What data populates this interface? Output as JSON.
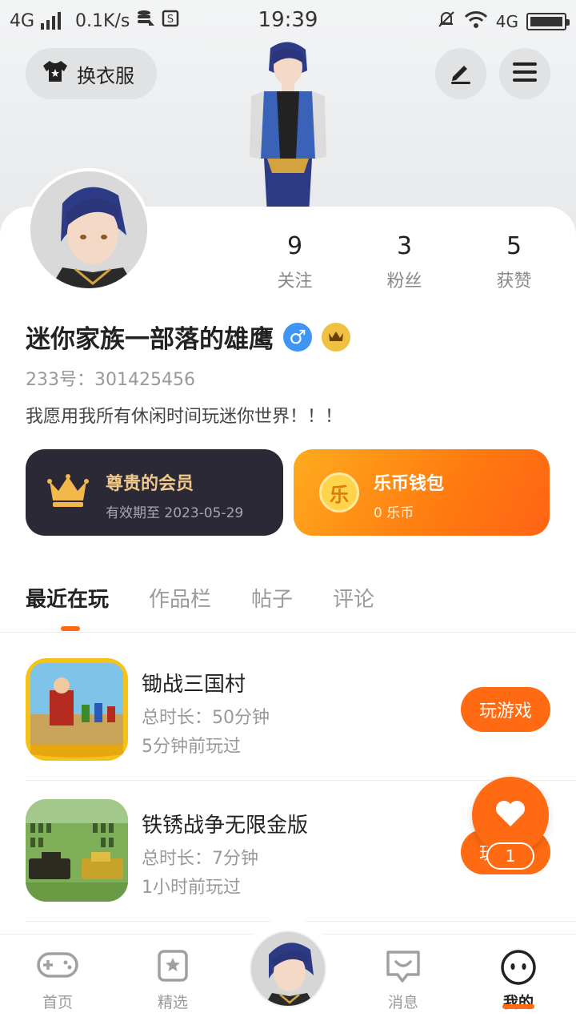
{
  "status_bar": {
    "network": "4G",
    "speed": "0.1K/s",
    "time": "19:39",
    "right_network": "4G"
  },
  "header": {
    "outfit_button_label": "换衣服",
    "edit_icon": "pencil-icon",
    "menu_icon": "menu-icon"
  },
  "profile": {
    "stats": [
      {
        "value": "9",
        "label": "关注"
      },
      {
        "value": "3",
        "label": "粉丝"
      },
      {
        "value": "5",
        "label": "获赞"
      }
    ],
    "nickname": "迷你家族一部落的雄鹰",
    "gender_symbol": "♂",
    "uid_text": "233号：301425456",
    "bio": "我愿用我所有休闲时间玩迷你世界！！！"
  },
  "member_card": {
    "title": "尊贵的会员",
    "subtitle": "有效期至 2023-05-29"
  },
  "wallet_card": {
    "coin_glyph": "乐",
    "title": "乐币钱包",
    "subtitle": "0 乐币"
  },
  "tabs": [
    {
      "label": "最近在玩",
      "active": true
    },
    {
      "label": "作品栏",
      "active": false
    },
    {
      "label": "帖子",
      "active": false
    },
    {
      "label": "评论",
      "active": false
    }
  ],
  "games": [
    {
      "name": "锄战三国村",
      "duration": "总时长：50分钟",
      "last_played": "5分钟前玩过",
      "button": "玩游戏"
    },
    {
      "name": "铁锈战争无限金版",
      "duration": "总时长：7分钟",
      "last_played": "1小时前玩过",
      "button": "玩游戏"
    }
  ],
  "like_fab": {
    "count": "1"
  },
  "bottom_nav": [
    {
      "label": "首页",
      "icon": "gamepad-icon",
      "active": false
    },
    {
      "label": "精选",
      "icon": "star-bookmark-icon",
      "active": false
    },
    {
      "label": "",
      "icon": "avatar-center",
      "active": false
    },
    {
      "label": "消息",
      "icon": "chat-bubble-icon",
      "active": false
    },
    {
      "label": "我的",
      "icon": "smiley-face-icon",
      "active": true
    }
  ],
  "colors": {
    "accent": "#ff6a12",
    "member_card_bg": "#2a2935",
    "member_gold": "#f0c88a",
    "gender_blue": "#3f95f3"
  }
}
